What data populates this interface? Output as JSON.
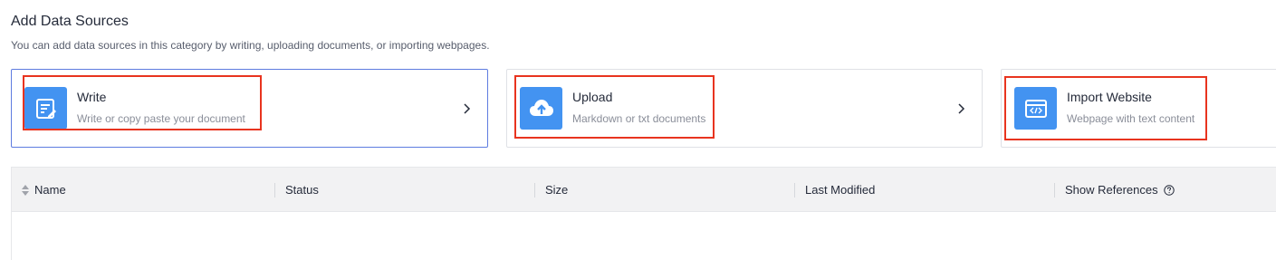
{
  "header": {
    "title": "Add Data Sources",
    "subtitle": "You can add data sources in this category by writing, uploading documents, or importing webpages."
  },
  "cards": [
    {
      "name": "Write",
      "description": "Write or copy paste your document",
      "icon": "edit-document-icon",
      "selected": true
    },
    {
      "name": "Upload",
      "description": "Markdown or txt documents",
      "icon": "cloud-upload-icon",
      "selected": false
    },
    {
      "name": "Import Website",
      "description": "Webpage with text content",
      "icon": "webpage-code-icon",
      "selected": false
    }
  ],
  "table": {
    "columns": [
      "Name",
      "Status",
      "Size",
      "Last Modified",
      "Show References"
    ],
    "rows": []
  },
  "colors": {
    "accent": "#5e7ce0",
    "icon_bg": "#4393f1",
    "highlight": "#e8341f",
    "header_bg": "#f2f2f3"
  }
}
